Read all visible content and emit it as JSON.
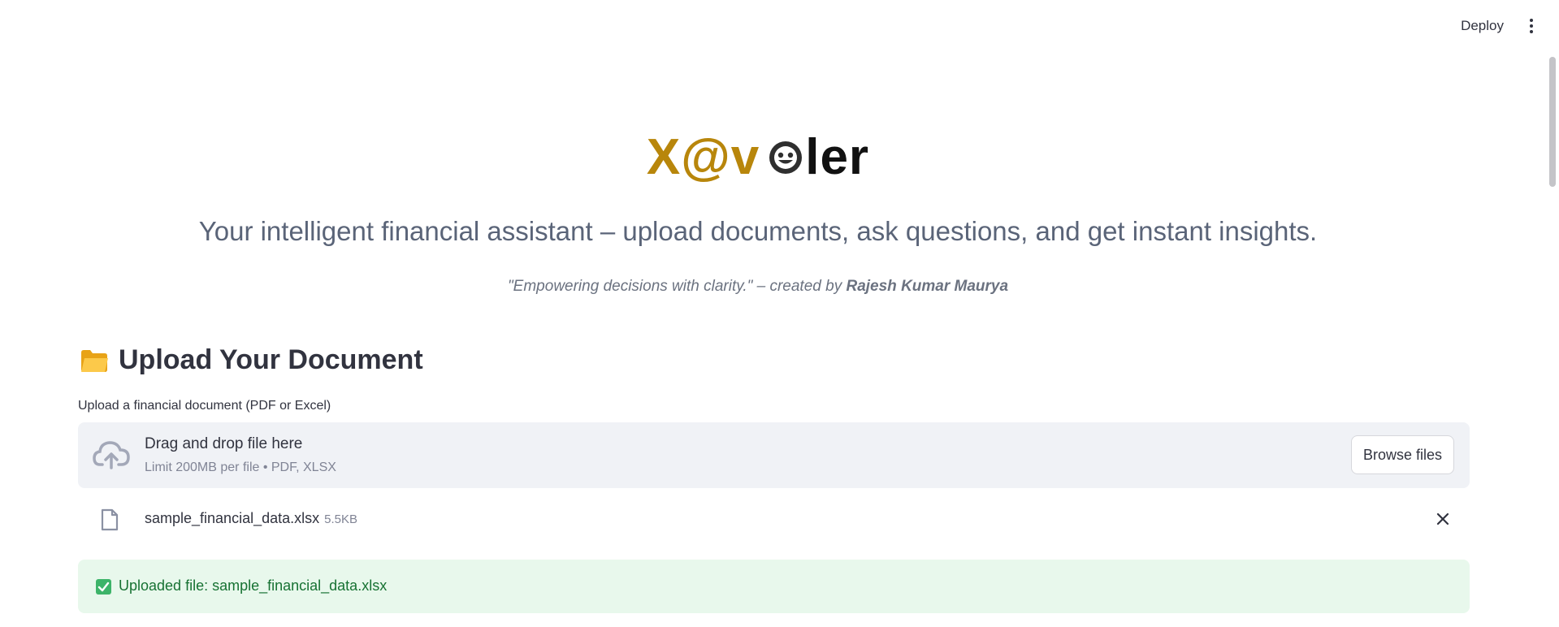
{
  "header": {
    "deploy_label": "Deploy",
    "menu_icon": "kebab-menu-icon"
  },
  "hero": {
    "logo_part1": "X@v",
    "logo_icon": "smiling-face-icon",
    "logo_part2": "ler",
    "tagline": "Your intelligent financial assistant – upload documents, ask questions, and get instant insights.",
    "quote": "\"Empowering decisions with clarity.\" – created by",
    "author": "Rajesh Kumar Maurya"
  },
  "upload_section": {
    "heading": "Upload Your Document",
    "heading_icon": "folder-icon",
    "label": "Upload a financial document (PDF or Excel)",
    "dropzone": {
      "icon": "cloud-upload-icon",
      "title": "Drag and drop file here",
      "limit": "Limit 200MB per file • PDF, XLSX",
      "browse_label": "Browse files"
    },
    "file": {
      "icon": "file-icon",
      "name": "sample_financial_data.xlsx",
      "size": "5.5KB",
      "remove_icon": "close-icon"
    },
    "success": {
      "icon": "checkbox-check-icon",
      "message": "Uploaded file: sample_financial_data.xlsx"
    }
  },
  "colors": {
    "logo_gold": "#b8860b",
    "success_bg": "#e8f8ec",
    "success_text": "#177233",
    "dropzone_bg": "#f0f2f6"
  }
}
